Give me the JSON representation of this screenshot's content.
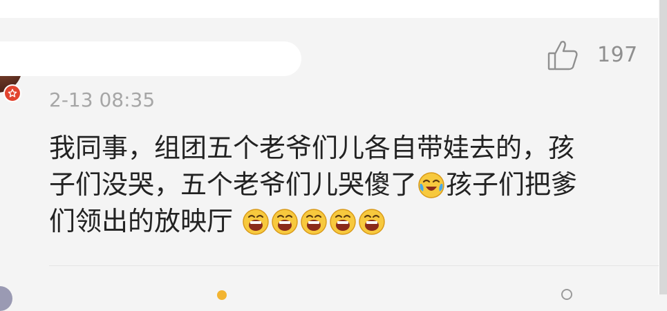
{
  "comment_card": {
    "like_count": "197",
    "timestamp": "2-13 08:35",
    "text_line_1": "我同事，组团五个老爷们儿各自带娃去的，孩",
    "text_line_2a": "子们没哭，五个老爷们儿哭傻了",
    "text_line_2b": "孩子们把爹",
    "text_line_3": "们领出的放映厅",
    "icons": {
      "like": "thumbs-up-icon",
      "badge": "verified-badge-icon",
      "crying_emoji": "crying-laughing-emoji",
      "laughing_emoji": "laughing-emoji"
    },
    "laughing_emoji_count": 5
  },
  "colors": {
    "background": "#f4f4f4",
    "text": "#222222",
    "muted": "#a6a6a6",
    "badge": "#e2442f"
  }
}
